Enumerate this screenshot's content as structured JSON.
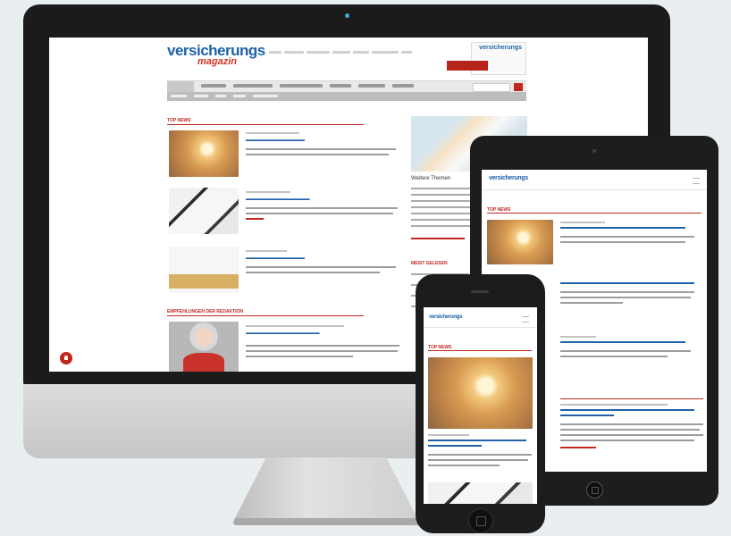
{
  "brand": {
    "logo_line1": "versicherungs",
    "logo_line2": "magazin",
    "mobile_logo": "versicherungs",
    "mobile_logo_accent": "magazin",
    "ad_logo": "versicherungs"
  },
  "colors": {
    "brand_blue": "#1f62a8",
    "brand_red": "#c0281e",
    "nav_grey": "#e9e9e9",
    "subnav_grey": "#bdbdbd",
    "device_black": "#1b1b1b"
  },
  "sections": {
    "top_news": "TOP NEWS",
    "second": "EMPFEHLUNGEN DER REDAKTION",
    "side_heading": "Weitere Themen",
    "side_section": "MEIST GELESEN"
  },
  "icons": {
    "search": "search-icon",
    "menu": "hamburger-menu-icon",
    "notification": "bell-icon",
    "home_button": "home-button-icon",
    "camera": "camera-icon"
  }
}
